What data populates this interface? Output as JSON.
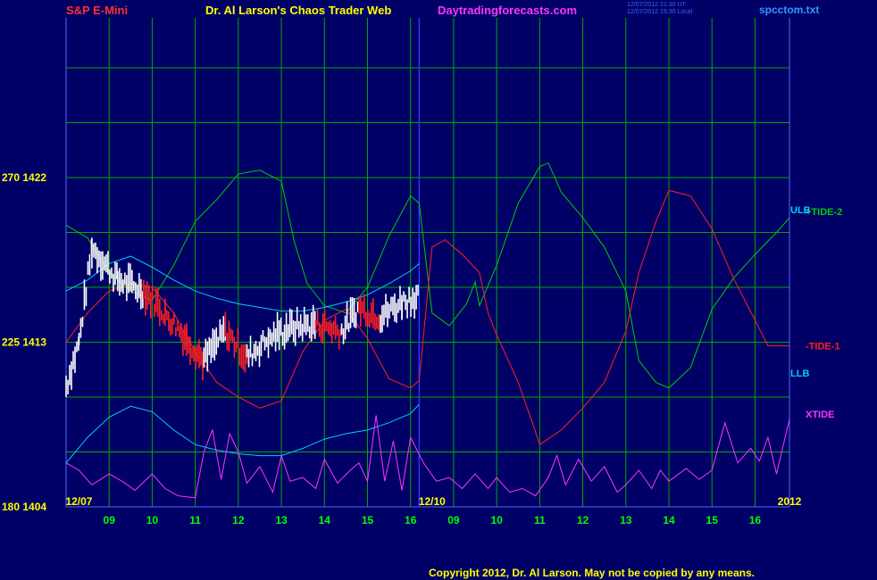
{
  "header": {
    "left_title": "S&P E-Mini",
    "center_title": "Dr. Al Larson's Chaos Trader Web",
    "site": "Daytradingforecasts.com",
    "timestamps": [
      "12/07/2012 21:30 UT",
      "12/07/2012 15:30 Local"
    ],
    "file": "spcctom.txt"
  },
  "footer": "Copyright 2012, Dr. Al Larson. May not be copied by any means.",
  "chart_data": {
    "type": "line",
    "y_ticks": [
      {
        "label": "270  1422",
        "price": 1422
      },
      {
        "label": "225  1413",
        "price": 1413
      },
      {
        "label": "180  1404",
        "price": 1404
      }
    ],
    "ylim": [
      1404,
      1422
    ],
    "date_labels": [
      {
        "label": "12/07",
        "x": 8.3
      },
      {
        "label": "12/10",
        "x": 16.5
      },
      {
        "label": "2012",
        "x": 24.8
      }
    ],
    "x_ticks": [
      "09",
      "10",
      "11",
      "12",
      "13",
      "14",
      "15",
      "16",
      "09",
      "10",
      "11",
      "12",
      "13",
      "14",
      "15",
      "16"
    ],
    "x_tick_positions": [
      9,
      10,
      11,
      12,
      13,
      14,
      15,
      16,
      17,
      18,
      19,
      20,
      21,
      22,
      23,
      24
    ],
    "now_x": 16.2,
    "series": [
      {
        "name": "+TIDE-2",
        "color": "#00cc00",
        "points": [
          [
            8,
            1419.4
          ],
          [
            8.5,
            1418.7
          ],
          [
            9,
            1416.8
          ],
          [
            9.5,
            1415.8
          ],
          [
            10,
            1415.3
          ],
          [
            10.5,
            1417.2
          ],
          [
            11,
            1419.6
          ],
          [
            11.5,
            1420.8
          ],
          [
            12,
            1422.2
          ],
          [
            12.5,
            1422.4
          ],
          [
            13,
            1421.8
          ],
          [
            13.3,
            1418.5
          ],
          [
            13.6,
            1416.2
          ],
          [
            14,
            1415.0
          ],
          [
            14.5,
            1414.6
          ],
          [
            15,
            1416.0
          ],
          [
            15.5,
            1418.8
          ],
          [
            16,
            1421.0
          ],
          [
            16.2,
            1420.6
          ],
          [
            16.5,
            1414.6
          ],
          [
            16.9,
            1413.9
          ],
          [
            17.3,
            1415.1
          ],
          [
            17.5,
            1416.3
          ],
          [
            17.6,
            1415.0
          ],
          [
            18,
            1417.2
          ],
          [
            18.5,
            1420.6
          ],
          [
            19,
            1422.6
          ],
          [
            19.2,
            1422.8
          ],
          [
            19.5,
            1421.2
          ],
          [
            20,
            1419.8
          ],
          [
            20.5,
            1418.2
          ],
          [
            21,
            1415.8
          ],
          [
            21.3,
            1412.0
          ],
          [
            21.7,
            1410.8
          ],
          [
            22,
            1410.5
          ],
          [
            22.5,
            1411.6
          ],
          [
            23,
            1414.8
          ],
          [
            23.5,
            1416.5
          ],
          [
            24,
            1417.8
          ],
          [
            24.5,
            1419.0
          ],
          [
            24.8,
            1419.8
          ]
        ]
      },
      {
        "name": "-TIDE-1",
        "color": "#ff2020",
        "points": [
          [
            8,
            1413.0
          ],
          [
            8.5,
            1414.6
          ],
          [
            9,
            1415.8
          ],
          [
            9.5,
            1416.2
          ],
          [
            10,
            1416.0
          ],
          [
            10.5,
            1414.6
          ],
          [
            11,
            1412.5
          ],
          [
            11.5,
            1410.8
          ],
          [
            12,
            1410.0
          ],
          [
            12.5,
            1409.4
          ],
          [
            13,
            1409.8
          ],
          [
            13.5,
            1412.5
          ],
          [
            14,
            1414.2
          ],
          [
            14.5,
            1414.8
          ],
          [
            15,
            1413.2
          ],
          [
            15.5,
            1411.0
          ],
          [
            16,
            1410.5
          ],
          [
            16.2,
            1410.9
          ],
          [
            16.5,
            1418.2
          ],
          [
            16.8,
            1418.6
          ],
          [
            17.2,
            1417.8
          ],
          [
            17.6,
            1416.8
          ],
          [
            17.8,
            1414.6
          ],
          [
            18,
            1413.4
          ],
          [
            18.5,
            1410.8
          ],
          [
            18.8,
            1408.8
          ],
          [
            19,
            1407.4
          ],
          [
            19.5,
            1408.2
          ],
          [
            20,
            1409.4
          ],
          [
            20.5,
            1410.8
          ],
          [
            21,
            1413.6
          ],
          [
            21.3,
            1416.8
          ],
          [
            21.7,
            1419.6
          ],
          [
            22,
            1421.3
          ],
          [
            22.5,
            1421.0
          ],
          [
            23,
            1419.2
          ],
          [
            23.5,
            1416.5
          ],
          [
            24,
            1414.2
          ],
          [
            24.3,
            1412.8
          ],
          [
            24.8,
            1412.8
          ]
        ]
      },
      {
        "name": "ULB",
        "color": "#00ccff",
        "points": [
          [
            8,
            1415.8
          ],
          [
            8.5,
            1416.4
          ],
          [
            9,
            1417.3
          ],
          [
            9.5,
            1417.7
          ],
          [
            10,
            1417.1
          ],
          [
            10.5,
            1416.4
          ],
          [
            11,
            1415.8
          ],
          [
            11.5,
            1415.4
          ],
          [
            12,
            1415.1
          ],
          [
            12.5,
            1414.9
          ],
          [
            13,
            1414.7
          ],
          [
            13.5,
            1414.7
          ],
          [
            14,
            1414.9
          ],
          [
            14.5,
            1415.2
          ],
          [
            15,
            1415.6
          ],
          [
            15.5,
            1416.2
          ],
          [
            16,
            1416.9
          ],
          [
            16.2,
            1417.3
          ]
        ]
      },
      {
        "name": "LLB",
        "color": "#00ccff",
        "points": [
          [
            8,
            1406.4
          ],
          [
            8.5,
            1407.8
          ],
          [
            9,
            1408.9
          ],
          [
            9.5,
            1409.5
          ],
          [
            10,
            1409.2
          ],
          [
            10.5,
            1408.2
          ],
          [
            11,
            1407.4
          ],
          [
            11.5,
            1407.1
          ],
          [
            12,
            1406.9
          ],
          [
            12.5,
            1406.8
          ],
          [
            13,
            1406.8
          ],
          [
            13.5,
            1407.2
          ],
          [
            14,
            1407.7
          ],
          [
            14.5,
            1408.0
          ],
          [
            15,
            1408.2
          ],
          [
            15.5,
            1408.6
          ],
          [
            16,
            1409.1
          ],
          [
            16.2,
            1409.6
          ]
        ]
      },
      {
        "name": "XTIDE",
        "color": "#ff33ff",
        "points": [
          [
            8,
            1406.4
          ],
          [
            8.3,
            1406.0
          ],
          [
            8.6,
            1405.2
          ],
          [
            9,
            1405.8
          ],
          [
            9.3,
            1405.4
          ],
          [
            9.6,
            1404.9
          ],
          [
            10,
            1405.8
          ],
          [
            10.3,
            1405.0
          ],
          [
            10.6,
            1404.6
          ],
          [
            11,
            1404.5
          ],
          [
            11.2,
            1407.0
          ],
          [
            11.4,
            1408.2
          ],
          [
            11.6,
            1405.5
          ],
          [
            11.8,
            1408.0
          ],
          [
            12,
            1407.0
          ],
          [
            12.2,
            1405.3
          ],
          [
            12.5,
            1406.2
          ],
          [
            12.8,
            1404.8
          ],
          [
            13,
            1406.8
          ],
          [
            13.2,
            1405.4
          ],
          [
            13.5,
            1405.6
          ],
          [
            13.8,
            1405.0
          ],
          [
            14,
            1406.6
          ],
          [
            14.3,
            1405.3
          ],
          [
            14.6,
            1406.0
          ],
          [
            14.8,
            1406.4
          ],
          [
            15,
            1405.4
          ],
          [
            15.2,
            1409.0
          ],
          [
            15.4,
            1405.4
          ],
          [
            15.6,
            1407.6
          ],
          [
            15.8,
            1404.9
          ],
          [
            16,
            1407.8
          ],
          [
            16.3,
            1406.4
          ],
          [
            16.6,
            1405.4
          ],
          [
            16.9,
            1405.6
          ],
          [
            17.2,
            1405.0
          ],
          [
            17.5,
            1405.8
          ],
          [
            17.8,
            1405.0
          ],
          [
            18,
            1405.6
          ],
          [
            18.3,
            1404.8
          ],
          [
            18.6,
            1405.0
          ],
          [
            18.9,
            1404.6
          ],
          [
            19.2,
            1405.6
          ],
          [
            19.4,
            1406.8
          ],
          [
            19.6,
            1405.2
          ],
          [
            19.9,
            1406.6
          ],
          [
            20.2,
            1405.4
          ],
          [
            20.5,
            1406.2
          ],
          [
            20.8,
            1404.8
          ],
          [
            21,
            1405.2
          ],
          [
            21.3,
            1406.0
          ],
          [
            21.6,
            1405.0
          ],
          [
            21.8,
            1406.0
          ],
          [
            22,
            1405.4
          ],
          [
            22.4,
            1406.1
          ],
          [
            22.7,
            1405.5
          ],
          [
            23,
            1406.0
          ],
          [
            23.3,
            1408.6
          ],
          [
            23.6,
            1406.4
          ],
          [
            23.9,
            1407.2
          ],
          [
            24.1,
            1406.5
          ],
          [
            24.3,
            1407.8
          ],
          [
            24.5,
            1405.8
          ],
          [
            24.8,
            1408.8
          ]
        ]
      }
    ],
    "price_bars": {
      "up_color": "#ffffff",
      "down_color": "#ff2020",
      "segments": [
        {
          "x0": 8.0,
          "x1": 8.3,
          "from": 1410.6,
          "to": 1413.0,
          "dir": "up"
        },
        {
          "x0": 8.3,
          "x1": 8.6,
          "from": 1413.0,
          "to": 1418.2,
          "dir": "up"
        },
        {
          "x0": 8.6,
          "x1": 9.2,
          "from": 1418.2,
          "to": 1416.4,
          "dir": "up"
        },
        {
          "x0": 9.2,
          "x1": 9.8,
          "from": 1416.4,
          "to": 1415.8,
          "dir": "up"
        },
        {
          "x0": 9.8,
          "x1": 10.3,
          "from": 1415.8,
          "to": 1414.6,
          "dir": "down"
        },
        {
          "x0": 10.3,
          "x1": 10.8,
          "from": 1414.6,
          "to": 1413.2,
          "dir": "down"
        },
        {
          "x0": 10.8,
          "x1": 11.2,
          "from": 1413.2,
          "to": 1412.0,
          "dir": "down"
        },
        {
          "x0": 11.2,
          "x1": 11.7,
          "from": 1412.0,
          "to": 1413.6,
          "dir": "up"
        },
        {
          "x0": 11.7,
          "x1": 12.2,
          "from": 1413.6,
          "to": 1412.2,
          "dir": "down"
        },
        {
          "x0": 12.2,
          "x1": 12.7,
          "from": 1412.2,
          "to": 1413.2,
          "dir": "up"
        },
        {
          "x0": 12.7,
          "x1": 13.2,
          "from": 1413.2,
          "to": 1413.8,
          "dir": "up"
        },
        {
          "x0": 13.2,
          "x1": 13.8,
          "from": 1413.8,
          "to": 1414.0,
          "dir": "up"
        },
        {
          "x0": 13.8,
          "x1": 14.4,
          "from": 1414.0,
          "to": 1413.6,
          "dir": "down"
        },
        {
          "x0": 14.4,
          "x1": 14.8,
          "from": 1413.6,
          "to": 1414.9,
          "dir": "up"
        },
        {
          "x0": 14.8,
          "x1": 15.3,
          "from": 1414.9,
          "to": 1414.4,
          "dir": "down"
        },
        {
          "x0": 15.3,
          "x1": 15.8,
          "from": 1414.4,
          "to": 1415.2,
          "dir": "up"
        },
        {
          "x0": 15.8,
          "x1": 16.2,
          "from": 1415.2,
          "to": 1415.6,
          "dir": "up"
        }
      ]
    }
  }
}
